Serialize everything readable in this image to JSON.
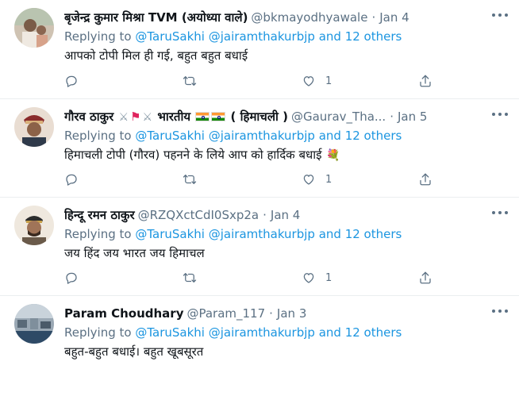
{
  "tweets": [
    {
      "name": "बृजेन्द्र कुमार मिश्रा TVM (अयोध्या वाले)",
      "handle": "@bkmayodhyawale",
      "date": "Jan 4",
      "reply_prefix": "Replying to ",
      "mention1": "@TaruSakhi",
      "mention2": "@jairamthakurbjp",
      "and_text": " and ",
      "others": "12 others",
      "text": "आपको टोपी मिल ही गई, बहुत बहुत बधाई",
      "likes": "1",
      "avatar_colors": [
        "#c7b9a6",
        "#6e5a4a"
      ]
    },
    {
      "name": "गौरव ठाकुर",
      "name_suffix": "भारतीय",
      "name_tail": "( हिमाचली )",
      "handle": "@Gaurav_Tha...",
      "date": "Jan 5",
      "reply_prefix": "Replying to ",
      "mention1": "@TaruSakhi",
      "mention2": "@jairamthakurbjp",
      "and_text": " and ",
      "others": "12 others",
      "text": "हिमाचली टोपी (गौरव) पहनने के लिये आप को हार्दिक बधाई",
      "text_emoji": "💐",
      "likes": "1",
      "avatar_colors": [
        "#d9c3b0",
        "#7a3a2c"
      ]
    },
    {
      "name": "हिन्दू रमन ठाकुर",
      "handle": "@RZQXctCdI0Sxp2a",
      "date": "Jan 4",
      "reply_prefix": "Replying to ",
      "mention1": "@TaruSakhi",
      "mention2": "@jairamthakurbjp",
      "and_text": " and ",
      "others": "12 others",
      "text": "जय हिंद जय भारत जय हिमाचल",
      "likes": "1",
      "avatar_colors": [
        "#e7ddd0",
        "#5a3e2e"
      ]
    },
    {
      "name": "Param Choudhary",
      "handle": "@Param_117",
      "date": "Jan 3",
      "reply_prefix": "Replying to ",
      "mention1": "@TaruSakhi",
      "mention2": "@jairamthakurbjp",
      "and_text": " and ",
      "others": "12 others",
      "text": "बहुत-बहुत बधाई। बहुत खूबसूरत",
      "avatar_colors": [
        "#6d7f8f",
        "#2e4a66"
      ]
    }
  ],
  "icons": {
    "reply": "reply-icon",
    "retweet": "retweet-icon",
    "like": "like-icon",
    "share": "share-icon",
    "more": "more-icon"
  },
  "colors": {
    "link": "#1b95e0",
    "secondary": "#5b7083",
    "divider": "#ebeef0"
  }
}
